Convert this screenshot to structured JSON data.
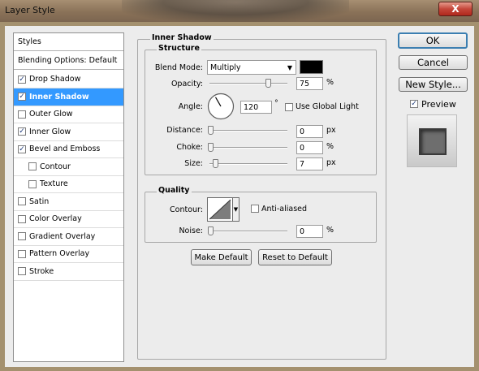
{
  "window": {
    "title": "Layer Style",
    "close_glyph": "X"
  },
  "styles_panel": {
    "header": "Styles",
    "blending": "Blending Options: Default",
    "items": [
      {
        "label": "Drop Shadow",
        "checked": true,
        "selected": false,
        "indent": false
      },
      {
        "label": "Inner Shadow",
        "checked": true,
        "selected": true,
        "indent": false
      },
      {
        "label": "Outer Glow",
        "checked": false,
        "selected": false,
        "indent": false
      },
      {
        "label": "Inner Glow",
        "checked": true,
        "selected": false,
        "indent": false
      },
      {
        "label": "Bevel and Emboss",
        "checked": true,
        "selected": false,
        "indent": false
      },
      {
        "label": "Contour",
        "checked": false,
        "selected": false,
        "indent": true
      },
      {
        "label": "Texture",
        "checked": false,
        "selected": false,
        "indent": true
      },
      {
        "label": "Satin",
        "checked": false,
        "selected": false,
        "indent": false
      },
      {
        "label": "Color Overlay",
        "checked": false,
        "selected": false,
        "indent": false
      },
      {
        "label": "Gradient Overlay",
        "checked": false,
        "selected": false,
        "indent": false
      },
      {
        "label": "Pattern Overlay",
        "checked": false,
        "selected": false,
        "indent": false
      },
      {
        "label": "Stroke",
        "checked": false,
        "selected": false,
        "indent": false
      }
    ]
  },
  "inner_shadow": {
    "group_title": "Inner Shadow",
    "structure_title": "Structure",
    "blend_mode_label": "Blend Mode:",
    "blend_mode_value": "Multiply",
    "shadow_color": "#000000",
    "opacity_label": "Opacity:",
    "opacity_value": "75",
    "opacity_unit": "%",
    "angle_label": "Angle:",
    "angle_value": "120",
    "angle_unit": "°",
    "global_light_label": "Use Global Light",
    "global_light_checked": false,
    "distance_label": "Distance:",
    "distance_value": "0",
    "distance_unit": "px",
    "choke_label": "Choke:",
    "choke_value": "0",
    "choke_unit": "%",
    "size_label": "Size:",
    "size_value": "7",
    "size_unit": "px",
    "quality_title": "Quality",
    "contour_label": "Contour:",
    "anti_aliased_label": "Anti-aliased",
    "anti_aliased_checked": false,
    "noise_label": "Noise:",
    "noise_value": "0",
    "noise_unit": "%",
    "make_default_label": "Make Default",
    "reset_default_label": "Reset to Default"
  },
  "actions": {
    "ok_label": "OK",
    "cancel_label": "Cancel",
    "new_style_label": "New Style...",
    "preview_label": "Preview",
    "preview_checked": true
  },
  "colors": {
    "selection": "#3399ff",
    "dialog_bg": "#ececec",
    "ok_border": "#3c7fb1"
  }
}
